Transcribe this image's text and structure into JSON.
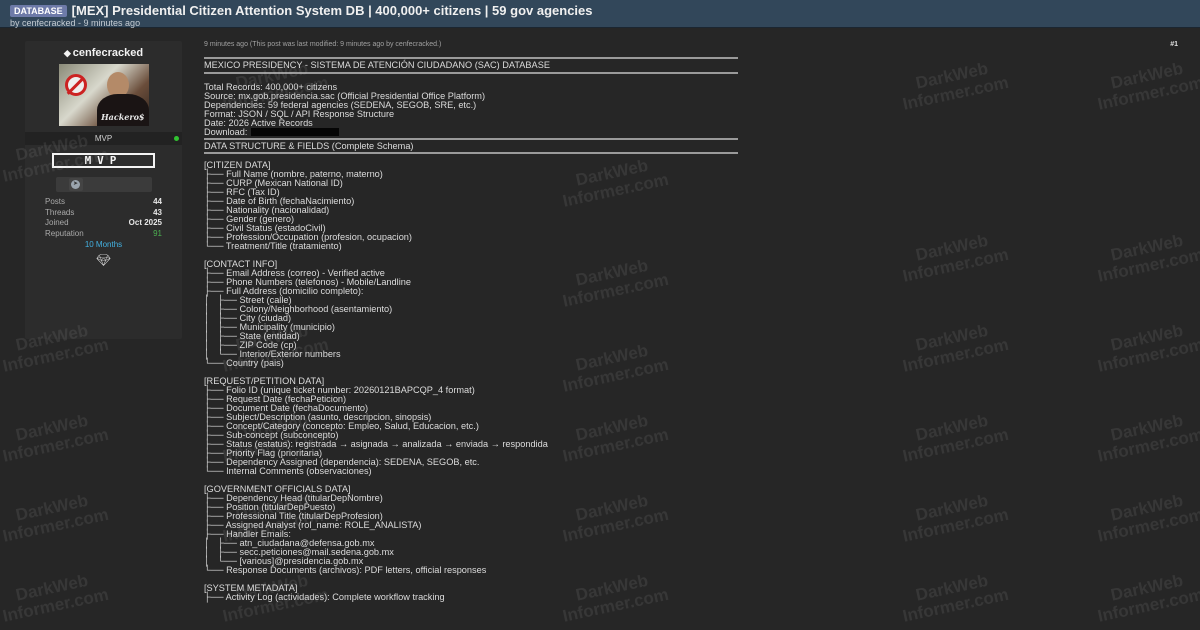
{
  "header": {
    "badge": "DATABASE",
    "title": "[MEX] Presidential Citizen Attention System DB | 400,000+ citizens | 59 gov agencies",
    "byline": "by cenfecracked - 9 minutes ago"
  },
  "profile": {
    "username": "cenfecracked",
    "avatar_tag": "Hackero$",
    "rank": "MVP",
    "rank_image_text": "MVP",
    "stats": [
      {
        "label": "Posts",
        "value": "44"
      },
      {
        "label": "Threads",
        "value": "43"
      },
      {
        "label": "Joined",
        "value": "Oct 2025"
      },
      {
        "label": "Reputation",
        "value": "91"
      }
    ],
    "months": "10 Months",
    "icons": {
      "online": "online-status",
      "contact": "telegram-icon",
      "award": "diamond-award-icon"
    },
    "colors": {
      "online": "#31c331",
      "months": "#43b0e0",
      "reputation": "#4caf50"
    }
  },
  "post": {
    "meta": "9 minutes ago  (This post was last modified: 9 minutes ago by cenfecracked.)",
    "number": "#1",
    "title": "MEXICO PRESIDENCY - SISTEMA DE ATENCIÓN CIUDADANO (SAC) DATABASE",
    "summary": [
      "Total Records: 400,000+ citizens",
      "Source: mx.gob.presidencia.sac (Official Presidential Office Platform)",
      "Dependencies: 59 federal agencies (SEDENA, SEGOB, SRE, etc.)",
      "Format: JSON / SQL / API Response Structure",
      "Date: 2026 Active Records"
    ],
    "download_label": "Download:",
    "schema_title": "DATA STRUCTURE & FIELDS (Complete Schema)",
    "sections": [
      {
        "heading": "[CITIZEN DATA]",
        "lines": [
          "├── Full Name (nombre, paterno, materno)",
          "├── CURP (Mexican National ID)",
          "├── RFC (Tax ID)",
          "├── Date of Birth (fechaNacimiento)",
          "├── Nationality (nacionalidad)",
          "├── Gender (genero)",
          "├── Civil Status (estadoCivil)",
          "├── Profession/Occupation (profesion, ocupacion)",
          "└── Treatment/Title (tratamiento)"
        ]
      },
      {
        "heading": "[CONTACT INFO]",
        "lines": [
          "├── Email Address (correo) - Verified active",
          "├── Phone Numbers (telefonos) - Mobile/Landline",
          "├── Full Address (domicilio completo):",
          "│   ├── Street (calle)",
          "│   ├── Colony/Neighborhood (asentamiento)",
          "│   ├── City (ciudad)",
          "│   ├── Municipality (municipio)",
          "│   ├── State (entidad)",
          "│   ├── ZIP Code (cp)",
          "│   └── Interior/Exterior numbers",
          "└── Country (pais)"
        ]
      },
      {
        "heading": "[REQUEST/PETITION DATA]",
        "lines": [
          "├── Folio ID (unique ticket number: 20260121BAPCQP_4 format)",
          "├── Request Date (fechaPeticion)",
          "├── Document Date (fechaDocumento)",
          "├── Subject/Description (asunto, descripcion, sinopsis)",
          "├── Concept/Category (concepto: Empleo, Salud, Educacion, etc.)",
          "├── Sub-concept (subconcepto)",
          "├── Status (estatus): registrada → asignada → analizada → enviada → respondida",
          "├── Priority Flag (prioritaria)",
          "├── Dependency Assigned (dependencia): SEDENA, SEGOB, etc.",
          "└── Internal Comments (observaciones)"
        ]
      },
      {
        "heading": "[GOVERNMENT OFFICIALS DATA]",
        "lines": [
          "├── Dependency Head (titularDepNombre)",
          "├── Position (titularDepPuesto)",
          "├── Professional Title (titularDepProfesion)",
          "├── Assigned Analyst (rol_name: ROLE_ANALISTA)",
          "├── Handler Emails:",
          "│   ├── atn_ciudadana@defensa.gob.mx",
          "│   ├── secc.peticiones@mail.sedena.gob.mx",
          "│   └── [various]@presidencia.gob.mx",
          "└── Response Documents (archivos): PDF letters, official responses"
        ]
      },
      {
        "heading": "[SYSTEM METADATA]",
        "lines": [
          "├── Activity Log (actividades): Complete workflow tracking"
        ]
      }
    ]
  },
  "watermark": {
    "line1": "DarkWeb",
    "line2": "Informer.com"
  }
}
